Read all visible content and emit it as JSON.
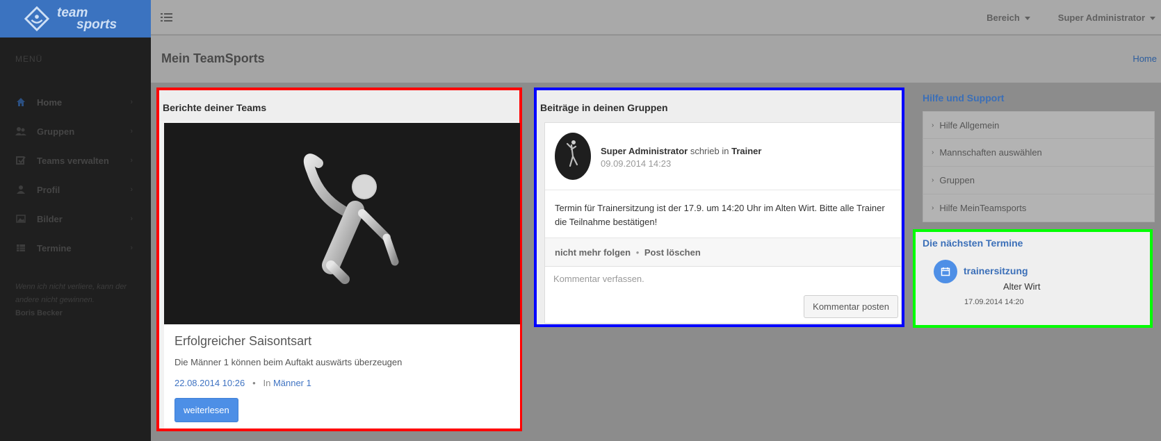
{
  "brand": {
    "line1": "team",
    "line2": "sports"
  },
  "sidebar": {
    "menu_title": "MENÜ",
    "items": [
      {
        "label": "Home",
        "icon": "home-icon"
      },
      {
        "label": "Gruppen",
        "icon": "users-icon"
      },
      {
        "label": "Teams verwalten",
        "icon": "checkbox-icon"
      },
      {
        "label": "Profil",
        "icon": "user-icon"
      },
      {
        "label": "Bilder",
        "icon": "image-icon"
      },
      {
        "label": "Termine",
        "icon": "table-icon"
      }
    ],
    "quote": {
      "text": "Wenn ich nicht verliere, kann der andere nicht gewinnen.",
      "author": "Boris Becker"
    }
  },
  "topbar": {
    "area": "Bereich",
    "user": "Super Administrator"
  },
  "page": {
    "title": "Mein TeamSports",
    "breadcrumb": "Home"
  },
  "reports": {
    "heading": "Berichte deiner Teams",
    "title": "Erfolgreicher Saisontsart",
    "subtitle": "Die Männer 1 können beim Auftakt auswärts überzeugen",
    "date": "22.08.2014 10:26",
    "separator": "•",
    "in_label": "In",
    "team": "Männer 1",
    "read_more": "weiterlesen"
  },
  "posts": {
    "heading": "Beiträge in deinen Gruppen",
    "author": "Super Administrator",
    "wrote_in": "schrieb in",
    "group": "Trainer",
    "time": "09.09.2014 14:23",
    "text": "Termin für Trainersitzung ist der 17.9. um 14:20 Uhr im Alten Wirt. Bitte alle Trainer die Teilnahme bestätigen!",
    "unfollow": "nicht mehr folgen",
    "separator": "•",
    "delete": "Post löschen",
    "comment_placeholder": "Kommentar verfassen.",
    "comment_button": "Kommentar posten"
  },
  "help": {
    "title": "Hilfe und Support",
    "items": [
      "Hilfe Allgemein",
      "Mannschaften auswählen",
      "Gruppen",
      "Hilfe MeinTeamsports"
    ]
  },
  "events": {
    "title": "Die nächsten Termine",
    "name": "trainersitzung",
    "place": "Alter Wirt",
    "date": "17.09.2014 14:20"
  },
  "colors": {
    "brand": "#3b73c0",
    "link": "#3b6fb8",
    "button": "#4d8fe6",
    "sidebar": "#1f1f1f"
  }
}
